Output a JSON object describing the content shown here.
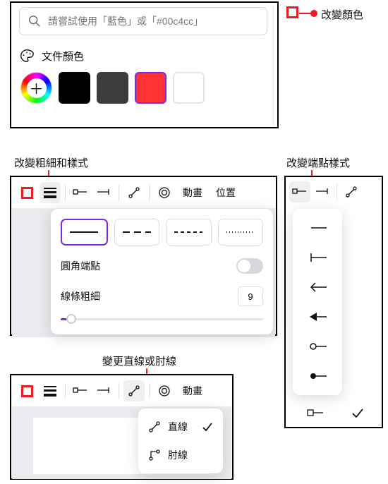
{
  "annotations": {
    "color": "改變顏色",
    "style": "改變粗細和樣式",
    "endpoints": "改變端點樣式",
    "lineType": "變更直線或肘線"
  },
  "search": {
    "placeholder": "請嘗試使用「藍色」或「#00c4cc」"
  },
  "docColors": {
    "label": "文件顏色",
    "swatches": [
      {
        "name": "add",
        "type": "add"
      },
      {
        "name": "black",
        "hex": "#000000"
      },
      {
        "name": "gray",
        "hex": "#3c3c3a"
      },
      {
        "name": "red",
        "hex": "#ff3333",
        "selected": true
      },
      {
        "name": "white",
        "hex": "#ffffff",
        "border": "#e5e5e5"
      }
    ]
  },
  "toolbar": {
    "animation": "動畫",
    "position": "位置"
  },
  "styleDropdown": {
    "roundedCap": "圓角端點",
    "lineWeight": "線條粗細",
    "weightValue": "9"
  },
  "lineTypeDropdown": {
    "straight": "直線",
    "elbow": "肘線"
  }
}
